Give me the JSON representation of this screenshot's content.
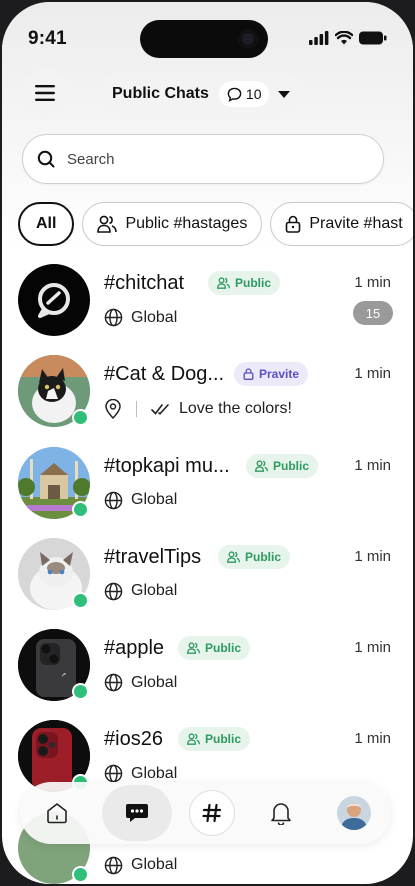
{
  "status_bar": {
    "time": "9:41"
  },
  "header": {
    "title": "Public Chats",
    "count": "10"
  },
  "search": {
    "placeholder": "Search"
  },
  "filters": [
    {
      "label": "All",
      "active": true
    },
    {
      "label": "Public #hastages",
      "icon": "users-icon"
    },
    {
      "label": "Pravite #hast",
      "icon": "lock-icon"
    }
  ],
  "chats": [
    {
      "name": "#chitchat",
      "badge": "Public",
      "time": "1 min",
      "sub": "Global",
      "sub_icon": "globe-icon",
      "unread": "15"
    },
    {
      "name": "#Cat & Dog...",
      "badge": "Pravite",
      "time": "1 min",
      "sub": "Love the colors!",
      "sub_icon": "location-icon"
    },
    {
      "name": "#topkapi mu...",
      "badge": "Public",
      "time": "1 min",
      "sub": "Global",
      "sub_icon": "globe-icon"
    },
    {
      "name": "#travelTips",
      "badge": "Public",
      "time": "1 min",
      "sub": "Global",
      "sub_icon": "globe-icon"
    },
    {
      "name": "#apple",
      "badge": "Public",
      "time": "1 min",
      "sub": "Global",
      "sub_icon": "globe-icon"
    },
    {
      "name": "#ios26",
      "badge": "Public",
      "time": "1 min",
      "sub": "Global",
      "sub_icon": "globe-icon"
    },
    {
      "name": "",
      "sub": "Global",
      "sub_icon": "globe-icon"
    }
  ],
  "colors": {
    "online": "#2fbf7a",
    "public": "#2e9a5f",
    "private": "#5a4fc4"
  }
}
